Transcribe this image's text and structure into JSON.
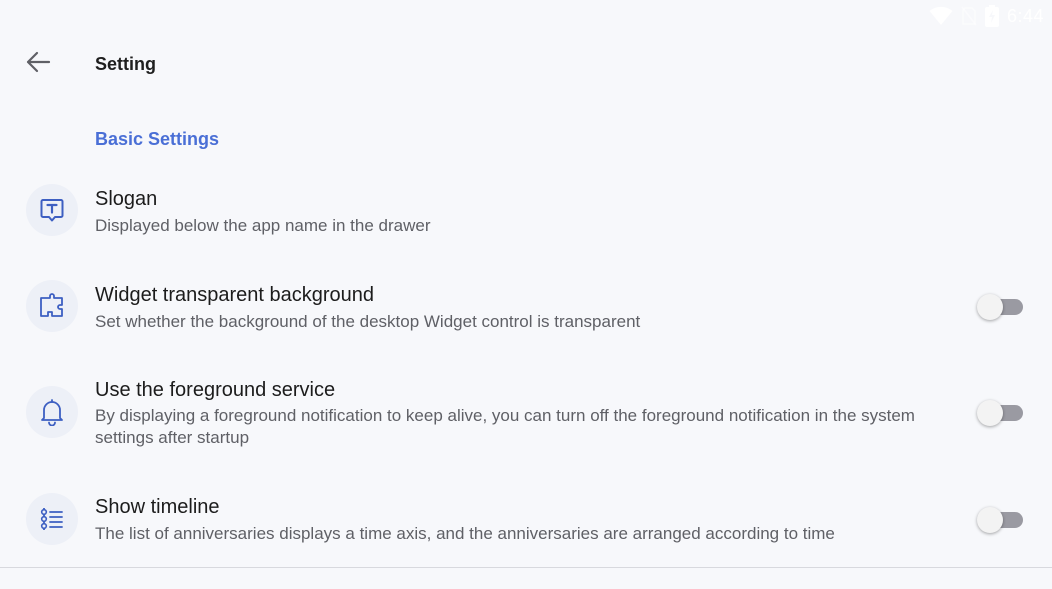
{
  "status_bar": {
    "time": "6:44",
    "icons": [
      "wifi-icon",
      "no-sim-icon",
      "battery-charging-icon"
    ]
  },
  "app_bar": {
    "title": "Setting",
    "back_icon": "arrow-back-icon"
  },
  "section": {
    "title": "Basic Settings"
  },
  "settings": [
    {
      "icon": "text-box-icon",
      "title": "Slogan",
      "description": "Displayed below the app name in the drawer",
      "has_toggle": false
    },
    {
      "icon": "widget-icon",
      "title": "Widget transparent background",
      "description": "Set whether the background of the desktop Widget control is transparent",
      "has_toggle": true,
      "toggle_on": false
    },
    {
      "icon": "bell-icon",
      "title": "Use the foreground service",
      "description": "By displaying a foreground notification to keep alive, you can turn off the foreground notification in the system settings after startup",
      "has_toggle": true,
      "toggle_on": false
    },
    {
      "icon": "timeline-icon",
      "title": "Show timeline",
      "description": "The list of anniversaries displays a time axis, and the anniversaries are arranged according to time",
      "has_toggle": true,
      "toggle_on": false
    }
  ],
  "colors": {
    "accent": "#4a6fd6",
    "background": "#f7f8fb",
    "icon_bg": "#edf0f7",
    "toggle_track_off": "#9a9aa2"
  }
}
